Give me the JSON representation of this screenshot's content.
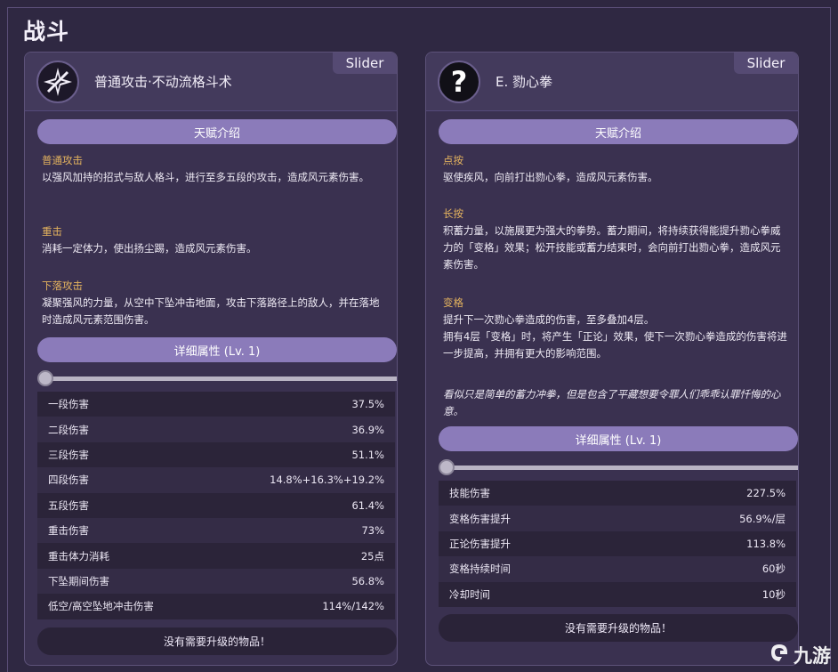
{
  "page": {
    "title": "战斗"
  },
  "cards": [
    {
      "slider_label": "Slider",
      "icon": "star-slash-icon",
      "skill_name": "普通攻击·不动流格斗术",
      "talent_header": "天赋介绍",
      "sections": [
        {
          "title": "普通攻击",
          "text": "以强风加持的招式与敌人格斗，进行至多五段的攻击，造成风元素伤害。"
        },
        {
          "title": "重击",
          "text": "消耗一定体力，使出扬尘踢，造成风元素伤害。"
        },
        {
          "title": "下落攻击",
          "text": "凝聚强风的力量，从空中下坠冲击地面，攻击下落路径上的敌人，并在落地时造成风元素范围伤害。"
        }
      ],
      "detail_header": "详细属性 (Lv. 1)",
      "level": 1,
      "stats": [
        {
          "label": "一段伤害",
          "value": "37.5%"
        },
        {
          "label": "二段伤害",
          "value": "36.9%"
        },
        {
          "label": "三段伤害",
          "value": "51.1%"
        },
        {
          "label": "四段伤害",
          "value": "14.8%+16.3%+19.2%"
        },
        {
          "label": "五段伤害",
          "value": "61.4%"
        },
        {
          "label": "重击伤害",
          "value": "73%"
        },
        {
          "label": "重击体力消耗",
          "value": "25点"
        },
        {
          "label": "下坠期间伤害",
          "value": "56.8%"
        },
        {
          "label": "低空/高空坠地冲击伤害",
          "value": "114%/142%"
        }
      ],
      "footer": "没有需要升级的物品！"
    },
    {
      "slider_label": "Slider",
      "icon": "question-mark-icon",
      "skill_name": "E. 勠心拳",
      "talent_header": "天赋介绍",
      "sections": [
        {
          "title": "点按",
          "text": "驱使疾风，向前打出勠心拳，造成风元素伤害。"
        },
        {
          "title": "长按",
          "text": "积蓄力量，以施展更为强大的拳势。蓄力期间，将持续获得能提升勠心拳威力的「变格」效果；松开技能或蓄力结束时，会向前打出勠心拳，造成风元素伤害。"
        },
        {
          "title": "变格",
          "text": "提升下一次勠心拳造成的伤害，至多叠加4层。\n拥有4层「变格」时，将产生「正论」效果，使下一次勠心拳造成的伤害将进一步提高，并拥有更大的影响范围。"
        }
      ],
      "flavor": "看似只是简单的蓄力冲拳，但是包含了平藏想要令罪人们乖乖认罪忏悔的心意。",
      "detail_header": "详细属性 (Lv. 1)",
      "level": 1,
      "stats": [
        {
          "label": "技能伤害",
          "value": "227.5%"
        },
        {
          "label": "变格伤害提升",
          "value": "56.9%/层"
        },
        {
          "label": "正论伤害提升",
          "value": "113.8%"
        },
        {
          "label": "变格持续时间",
          "value": "60秒"
        },
        {
          "label": "冷却时间",
          "value": "10秒"
        }
      ],
      "footer": "没有需要升级的物品！"
    }
  ],
  "watermark": {
    "text": "九游",
    "icon": "nine-game-logo-icon"
  }
}
